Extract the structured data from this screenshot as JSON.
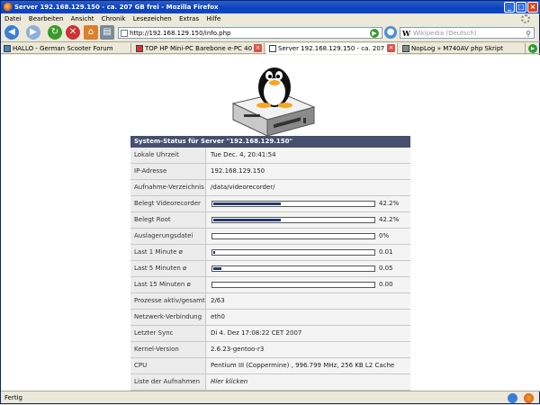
{
  "window": {
    "title": "Server 192.168.129.150 - ca. 207 GB frei - Mozilla Firefox"
  },
  "menu": [
    "Datei",
    "Bearbeiten",
    "Ansicht",
    "Chronik",
    "Lesezeichen",
    "Extras",
    "Hilfe"
  ],
  "address": {
    "url": "http://192.168.129.150/info.php"
  },
  "search": {
    "placeholder": "Wikipedia (Deutsch)"
  },
  "tabs": [
    {
      "label": "HALLO - German Scooter Forum"
    },
    {
      "label": "TOP HP Mini-PC Barebone e-PC 40 ..."
    },
    {
      "label": "Server 192.168.129.150 - ca. 207 ..."
    },
    {
      "label": "NopLog » M740AV php Skript"
    }
  ],
  "panel": {
    "title": "System-Status für Server \"192.168.129.150\"",
    "rows": [
      {
        "label": "Lokale Uhrzeit",
        "value": "Tue Dec. 4, 20:41:54"
      },
      {
        "label": "IP-Adresse",
        "value": "192.168.129.150"
      },
      {
        "label": "Aufnahme-Verzeichnis",
        "value": "/data/videorecorder/"
      },
      {
        "label": "Belegt Videorecorder",
        "value": "42.2%",
        "bar": 0.422
      },
      {
        "label": "Belegt Root",
        "value": "42.2%",
        "bar": 0.422
      },
      {
        "label": "Auslagerungsdatei",
        "value": "0%",
        "bar": 0
      },
      {
        "label": "Last 1 Minute ø",
        "value": "0.01",
        "bar": 0.01
      },
      {
        "label": "Last 5 Minuten ø",
        "value": "0.05",
        "bar": 0.05
      },
      {
        "label": "Last 15 Minuten ø",
        "value": "0.00",
        "bar": 0
      },
      {
        "label": "Prozesse aktiv/gesamt",
        "value": "2/63"
      },
      {
        "label": "Netzwerk-Verbindung",
        "value": "eth0"
      },
      {
        "label": "Letzter Sync",
        "value": "Di 4. Dez 17:08:22 CET 2007"
      },
      {
        "label": "Kernel-Version",
        "value": "2.6.23-gentoo-r3"
      },
      {
        "label": "CPU",
        "value": "Pentium III (Coppermine) , 996.799 MHz, 256 KB L2 Cache"
      },
      {
        "label": "Liste der Aufnahmen",
        "value": "Hier klicken"
      }
    ]
  },
  "status": {
    "text": "Fertig"
  }
}
